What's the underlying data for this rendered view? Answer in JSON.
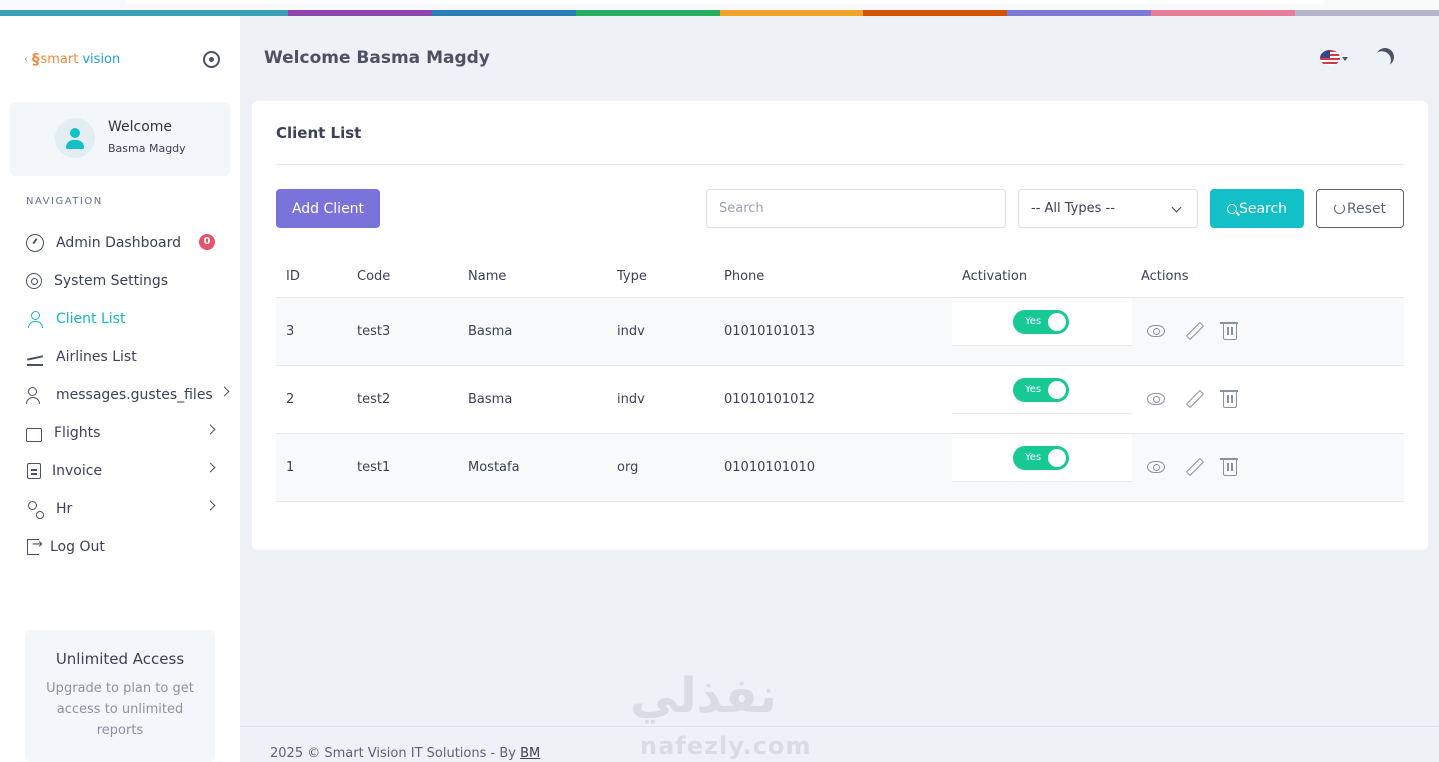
{
  "brand": {
    "logo_smart": "smart",
    "logo_vision": "vision",
    "colors": {
      "accent": "#14c0c8",
      "primary_button": "#7a73db",
      "toggle_on": "#16c995",
      "badge": "#e8536b"
    }
  },
  "user_card": {
    "title": "Welcome",
    "name": "Basma Magdy"
  },
  "sidebar": {
    "nav_label": "NAVIGATION",
    "items": [
      {
        "label": "Admin Dashboard",
        "icon": "gauge-icon",
        "badge": "0"
      },
      {
        "label": "System Settings",
        "icon": "gear-icon"
      },
      {
        "label": "Client List",
        "icon": "user-icon",
        "active": true
      },
      {
        "label": "Airlines List",
        "icon": "plane-icon"
      },
      {
        "label": "messages.gustes_files",
        "icon": "users-icon",
        "has_submenu": true
      },
      {
        "label": "Flights",
        "icon": "ticket-icon",
        "has_submenu": true
      },
      {
        "label": "Invoice",
        "icon": "invoice-icon",
        "has_submenu": true
      },
      {
        "label": "Hr",
        "icon": "hr-icon",
        "has_submenu": true
      },
      {
        "label": "Log Out",
        "icon": "logout-icon"
      }
    ],
    "upgrade": {
      "title": "Unlimited Access",
      "description": "Upgrade to plan to get access to unlimited reports"
    }
  },
  "header": {
    "welcome": "Welcome Basma Magdy",
    "language_icon": "us-flag-icon",
    "theme_icon": "moon-icon"
  },
  "client_list": {
    "title": "Client List",
    "add_button": "Add Client",
    "search_placeholder": "Search",
    "type_filter": "-- All Types --",
    "search_button": "Search",
    "reset_button": "Reset",
    "columns": [
      "ID",
      "Code",
      "Name",
      "Type",
      "Phone",
      "Activation",
      "Actions"
    ],
    "rows": [
      {
        "id": "3",
        "code": "test3",
        "name": "Basma",
        "type": "indv",
        "phone": "01010101013",
        "activation": "Yes"
      },
      {
        "id": "2",
        "code": "test2",
        "name": "Basma",
        "type": "indv",
        "phone": "01010101012",
        "activation": "Yes"
      },
      {
        "id": "1",
        "code": "test1",
        "name": "Mostafa",
        "type": "org",
        "phone": "01010101010",
        "activation": "Yes"
      }
    ]
  },
  "footer": {
    "text": "2025 © Smart Vision IT Solutions - By",
    "link": "BM"
  },
  "watermark": {
    "arabic": "نفذلي",
    "latin": "nafezly.com"
  }
}
